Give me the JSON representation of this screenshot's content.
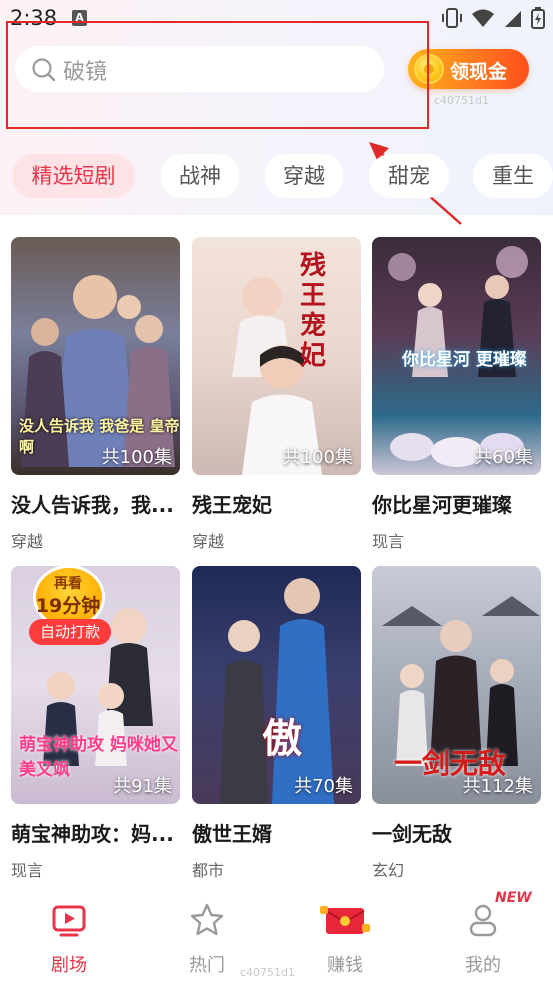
{
  "status_bar": {
    "time": "2:38",
    "a_icon": "A"
  },
  "search": {
    "placeholder": "破镜"
  },
  "cash_button": {
    "label": "领现金"
  },
  "watermark": "c40751d1",
  "tabs": [
    {
      "label": "精选短剧",
      "active": true
    },
    {
      "label": "战神",
      "active": false
    },
    {
      "label": "穿越",
      "active": false
    },
    {
      "label": "甜宠",
      "active": false
    },
    {
      "label": "重生",
      "active": false
    }
  ],
  "dramas": [
    {
      "title": "没人告诉我，我...",
      "genre": "穿越",
      "episodes": "共100集",
      "poster_text": "没人告诉我 我爸是 皇帝啊"
    },
    {
      "title": "残王宠妃",
      "genre": "穿越",
      "episodes": "共100集",
      "poster_text": "残王宠妃"
    },
    {
      "title": "你比星河更璀璨",
      "genre": "现言",
      "episodes": "共60集",
      "poster_text": "你比星河 更璀璨"
    },
    {
      "title": "萌宝神助攻：妈...",
      "genre": "现言",
      "episodes": "共91集",
      "poster_text": "萌宝神助攻 妈咪她又美又飒"
    },
    {
      "title": "傲世王婿",
      "genre": "都市",
      "episodes": "共70集",
      "poster_text": "傲"
    },
    {
      "title": "一剑无敌",
      "genre": "玄幻",
      "episodes": "共112集",
      "poster_text": "一剑无敌"
    }
  ],
  "timer_badge": {
    "line1": "再看",
    "line2": "19分钟",
    "button": "自动打款"
  },
  "bottom_nav": [
    {
      "label": "剧场",
      "icon": "play-icon",
      "active": true
    },
    {
      "label": "热门",
      "icon": "star-icon",
      "active": false
    },
    {
      "label": "赚钱",
      "icon": "red-envelope-icon",
      "active": false
    },
    {
      "label": "我的",
      "icon": "person-icon",
      "active": false
    }
  ],
  "new_badge": "NEW",
  "colors": {
    "accent": "#e8344a",
    "cash_gradient_start": "#ffb31a",
    "cash_gradient_end": "#ff4f1c"
  }
}
